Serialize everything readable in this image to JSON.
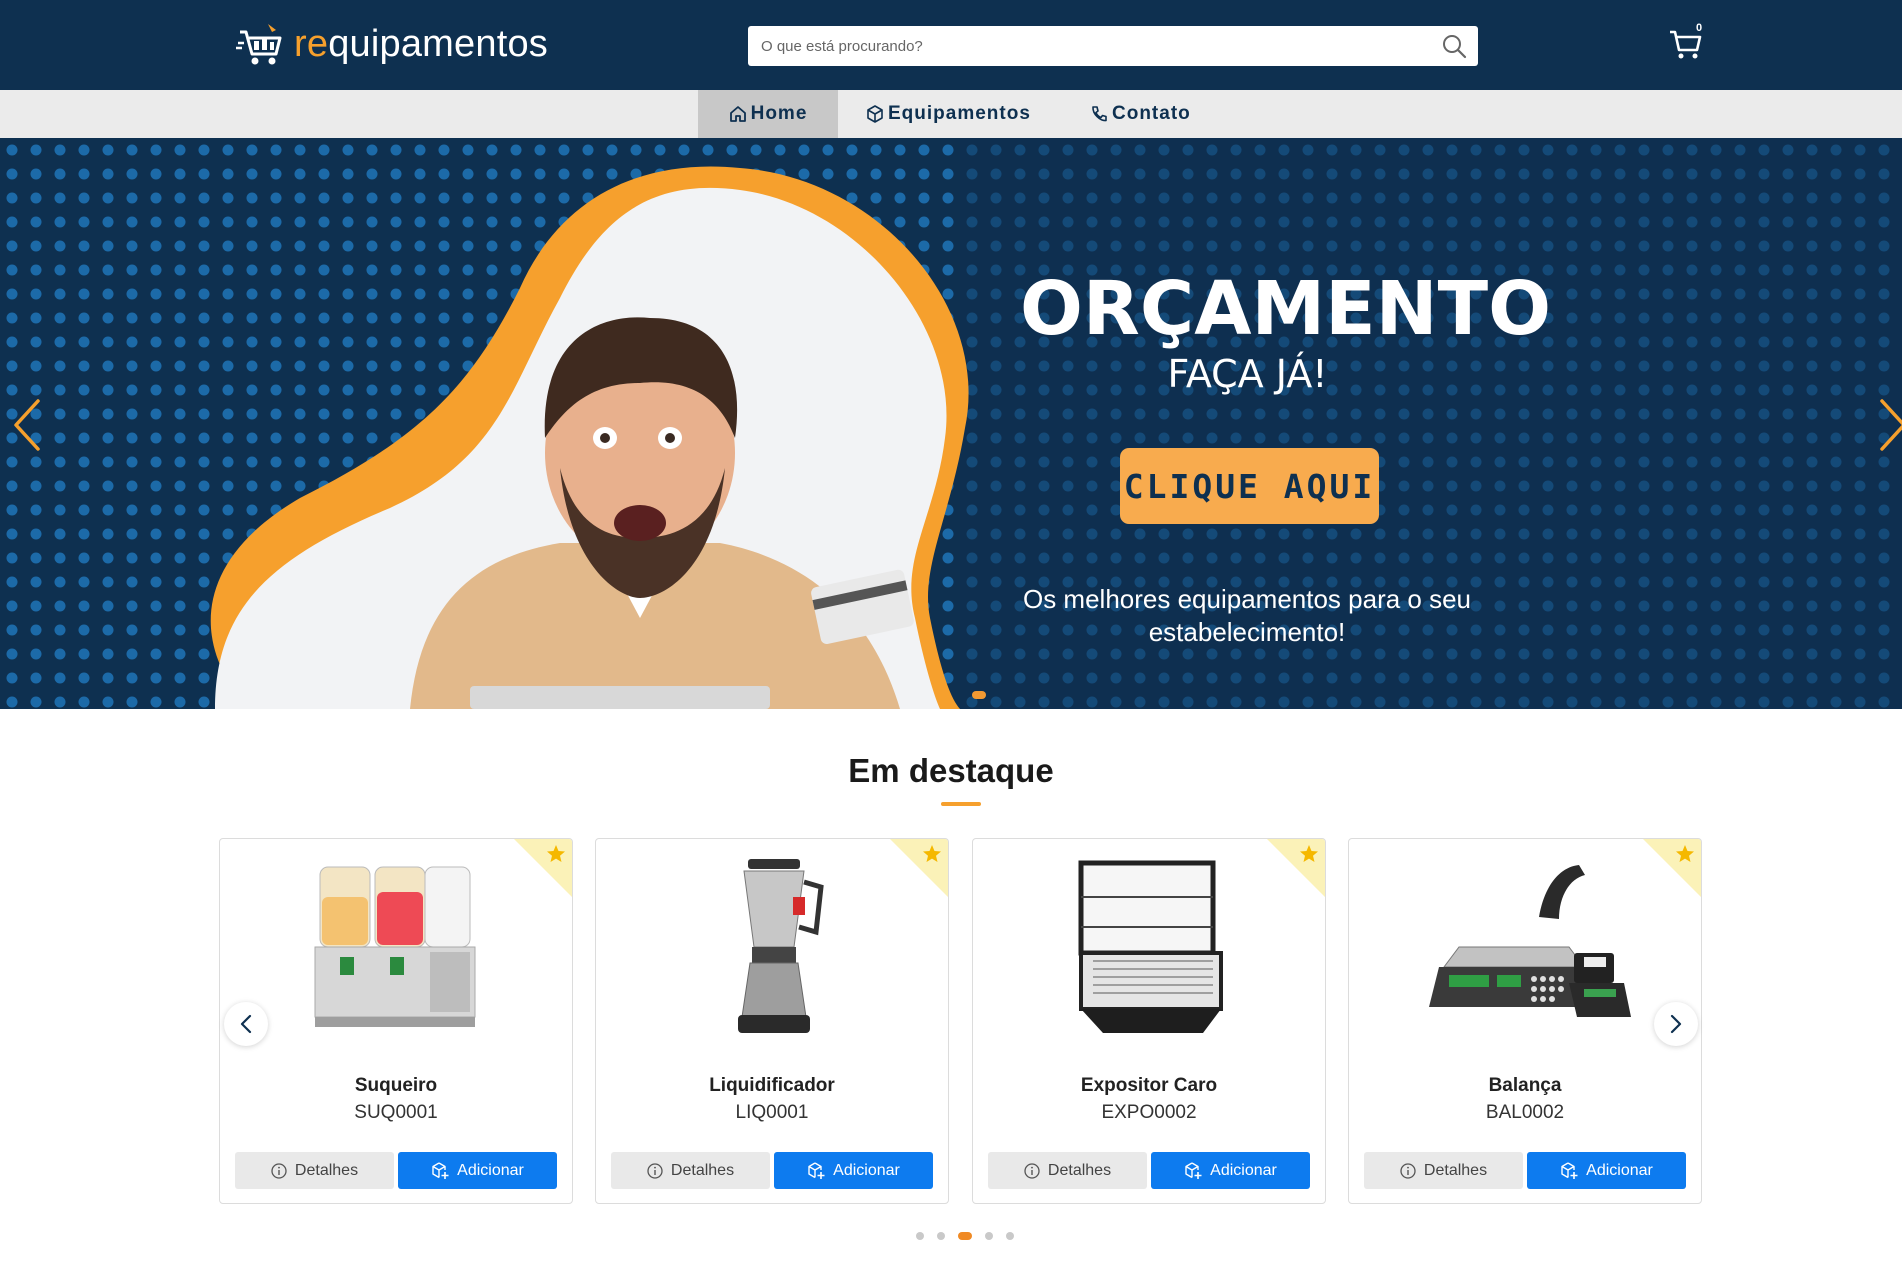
{
  "header": {
    "logo_prefix": "re",
    "logo_rest": "quipamentos",
    "search_placeholder": "O que está procurando?",
    "cart_count": "0"
  },
  "nav": {
    "home": "Home",
    "equipamentos": "Equipamentos",
    "contato": "Contato"
  },
  "hero": {
    "title": "ORÇAMENTO",
    "subtitle": "FAÇA JÁ!",
    "cta": "CLIQUE AQUI",
    "tagline": "Os melhores equipamentos para o seu estabelecimento!"
  },
  "featured": {
    "title": "Em destaque",
    "details_label": "Detalhes",
    "add_label": "Adicionar",
    "products": [
      {
        "name": "Suqueiro",
        "code": "SUQ0001"
      },
      {
        "name": "Liquidificador",
        "code": "LIQ0001"
      },
      {
        "name": "Expositor Caro",
        "code": "EXPO0002"
      },
      {
        "name": "Balança",
        "code": "BAL0002"
      }
    ],
    "pager": {
      "total": 5,
      "active": 3
    }
  },
  "colors": {
    "navy": "#0e3050",
    "orange": "#f6a02d",
    "blue_button": "#0d7bef"
  }
}
